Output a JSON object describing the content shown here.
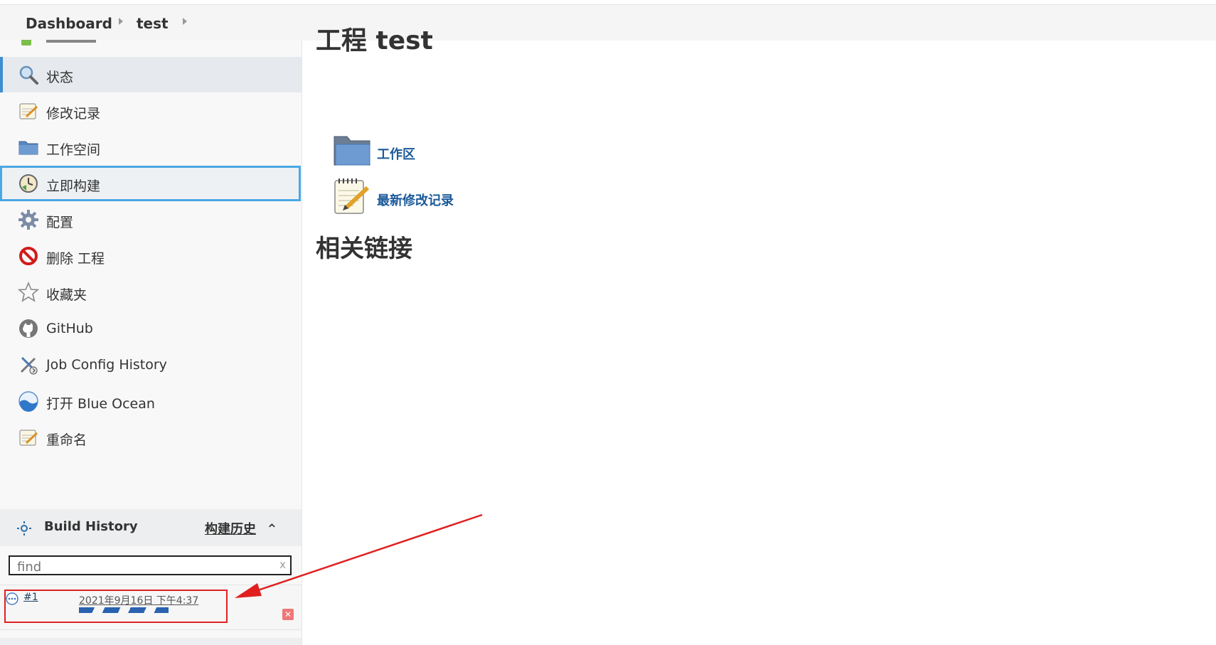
{
  "breadcrumb": {
    "items": [
      "Dashboard",
      "test"
    ]
  },
  "sidebar": {
    "items": [
      {
        "label": "状态",
        "icon": "search-icon"
      },
      {
        "label": "修改记录",
        "icon": "notepad-icon"
      },
      {
        "label": "工作空间",
        "icon": "folder-icon"
      },
      {
        "label": "立即构建",
        "icon": "clock-build-icon"
      },
      {
        "label": "配置",
        "icon": "gear-icon"
      },
      {
        "label": "删除 工程",
        "icon": "no-entry-icon"
      },
      {
        "label": "收藏夹",
        "icon": "star-icon"
      },
      {
        "label": "GitHub",
        "icon": "github-icon"
      },
      {
        "label": "Job Config History",
        "icon": "tools-icon"
      },
      {
        "label": "打开 Blue Ocean",
        "icon": "blue-ocean-icon"
      },
      {
        "label": "重命名",
        "icon": "notepad-icon"
      }
    ]
  },
  "build_history": {
    "title": "Build History",
    "link": "构建历史",
    "search_placeholder": "find",
    "clear": "x",
    "builds": [
      {
        "number": "#1",
        "date": "2021年9月16日 下午4:37"
      }
    ]
  },
  "main": {
    "title": "工程 test",
    "links": [
      {
        "label": "工作区",
        "icon": "folder-icon"
      },
      {
        "label": "最新修改记录",
        "icon": "notepad-icon"
      }
    ],
    "related_heading": "相关链接"
  },
  "colors": {
    "accent": "#3d8fd0",
    "focus_border": "#4aa8e4",
    "annotation": "#e02020",
    "link": "#1c5a9a"
  }
}
